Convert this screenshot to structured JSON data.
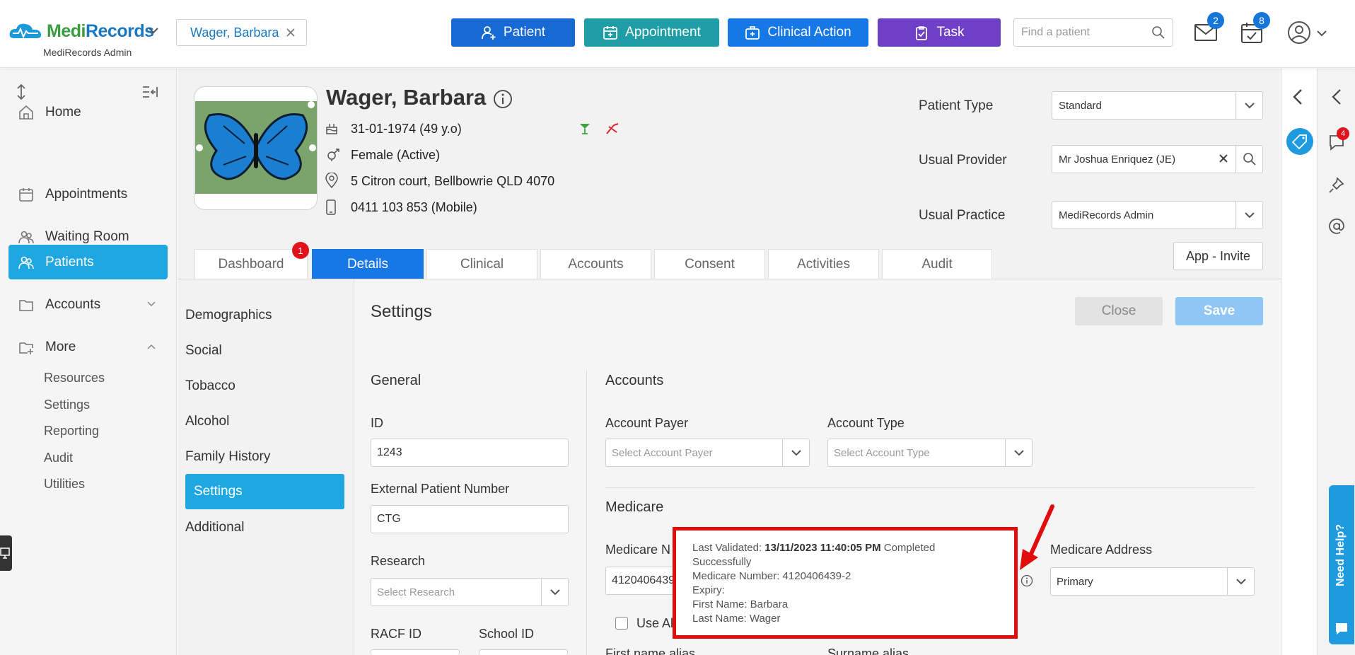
{
  "app": {
    "logo_a": "Medi",
    "logo_b": "Records",
    "subtitle": "MediRecords Admin"
  },
  "patient_chip": "Wager, Barbara",
  "top_actions": {
    "patient": "Patient",
    "appointment": "Appointment",
    "clinical_action": "Clinical Action",
    "task": "Task"
  },
  "search": {
    "placeholder": "Find a patient"
  },
  "badges": {
    "messages": "2",
    "calendar": "8",
    "comments": "4",
    "tabs_dashboard": "1"
  },
  "sidebar": {
    "items": [
      "Home",
      "Appointments",
      "Waiting Room",
      "Patients",
      "Accounts",
      "More"
    ],
    "sub_items": [
      "Resources",
      "Settings",
      "Reporting",
      "Audit",
      "Utilities"
    ]
  },
  "patient": {
    "name": "Wager, Barbara",
    "dob": "31-01-1974 (49 y.o)",
    "gender": "Female (Active)",
    "address": "5 Citron court, Bellbowrie QLD 4070",
    "phone": "0411 103 853 (Mobile)"
  },
  "header_fields": {
    "patient_type_label": "Patient Type",
    "patient_type": "Standard",
    "usual_provider_label": "Usual Provider",
    "usual_provider": "Mr Joshua Enriquez (JE)",
    "usual_practice_label": "Usual Practice",
    "usual_practice": "MediRecords Admin",
    "app_invite": "App - Invite"
  },
  "tabs": [
    "Dashboard",
    "Details",
    "Clinical",
    "Accounts",
    "Consent",
    "Activities",
    "Audit"
  ],
  "details_menu": [
    "Demographics",
    "Social",
    "Tobacco",
    "Alcohol",
    "Family History",
    "Settings",
    "Additional"
  ],
  "settings": {
    "title": "Settings",
    "close": "Close",
    "save": "Save",
    "general_heading": "General",
    "id_label": "ID",
    "id_value": "1243",
    "ext_label": "External Patient Number",
    "ext_value": "CTG",
    "research_label": "Research",
    "research_placeholder": "Select Research",
    "racf_label": "RACF ID",
    "school_label": "School ID",
    "accounts_heading": "Accounts",
    "payer_label": "Account Payer",
    "payer_placeholder": "Select Account Payer",
    "type_label": "Account Type",
    "type_placeholder": "Select Account Type",
    "medicare_heading": "Medicare",
    "medicare_num_label": "Medicare N",
    "medicare_num_value": "4120406439",
    "medicare_addr_label": "Medicare Address",
    "medicare_addr_value": "Primary",
    "use_alias": "Use Al",
    "first_alias": "First name alias",
    "surname_alias": "Surname alias"
  },
  "tooltip": {
    "l1_label": "Last Validated: ",
    "l1_value": "13/11/2023 11:40:05 PM",
    "l1_suffix": " Completed",
    "l2": "Successfully",
    "l3": "Medicare Number: 4120406439-2",
    "l4": "Expiry:",
    "l5": "First Name: Barbara",
    "l6": "Last Name: Wager"
  },
  "need_help": "Need Help?",
  "colors": {
    "accent": "#1ea7e1",
    "primary_blue": "#1677e6",
    "teal": "#1f9ea8",
    "purple": "#6f3fc8",
    "annotation_red": "#e10d0d"
  }
}
